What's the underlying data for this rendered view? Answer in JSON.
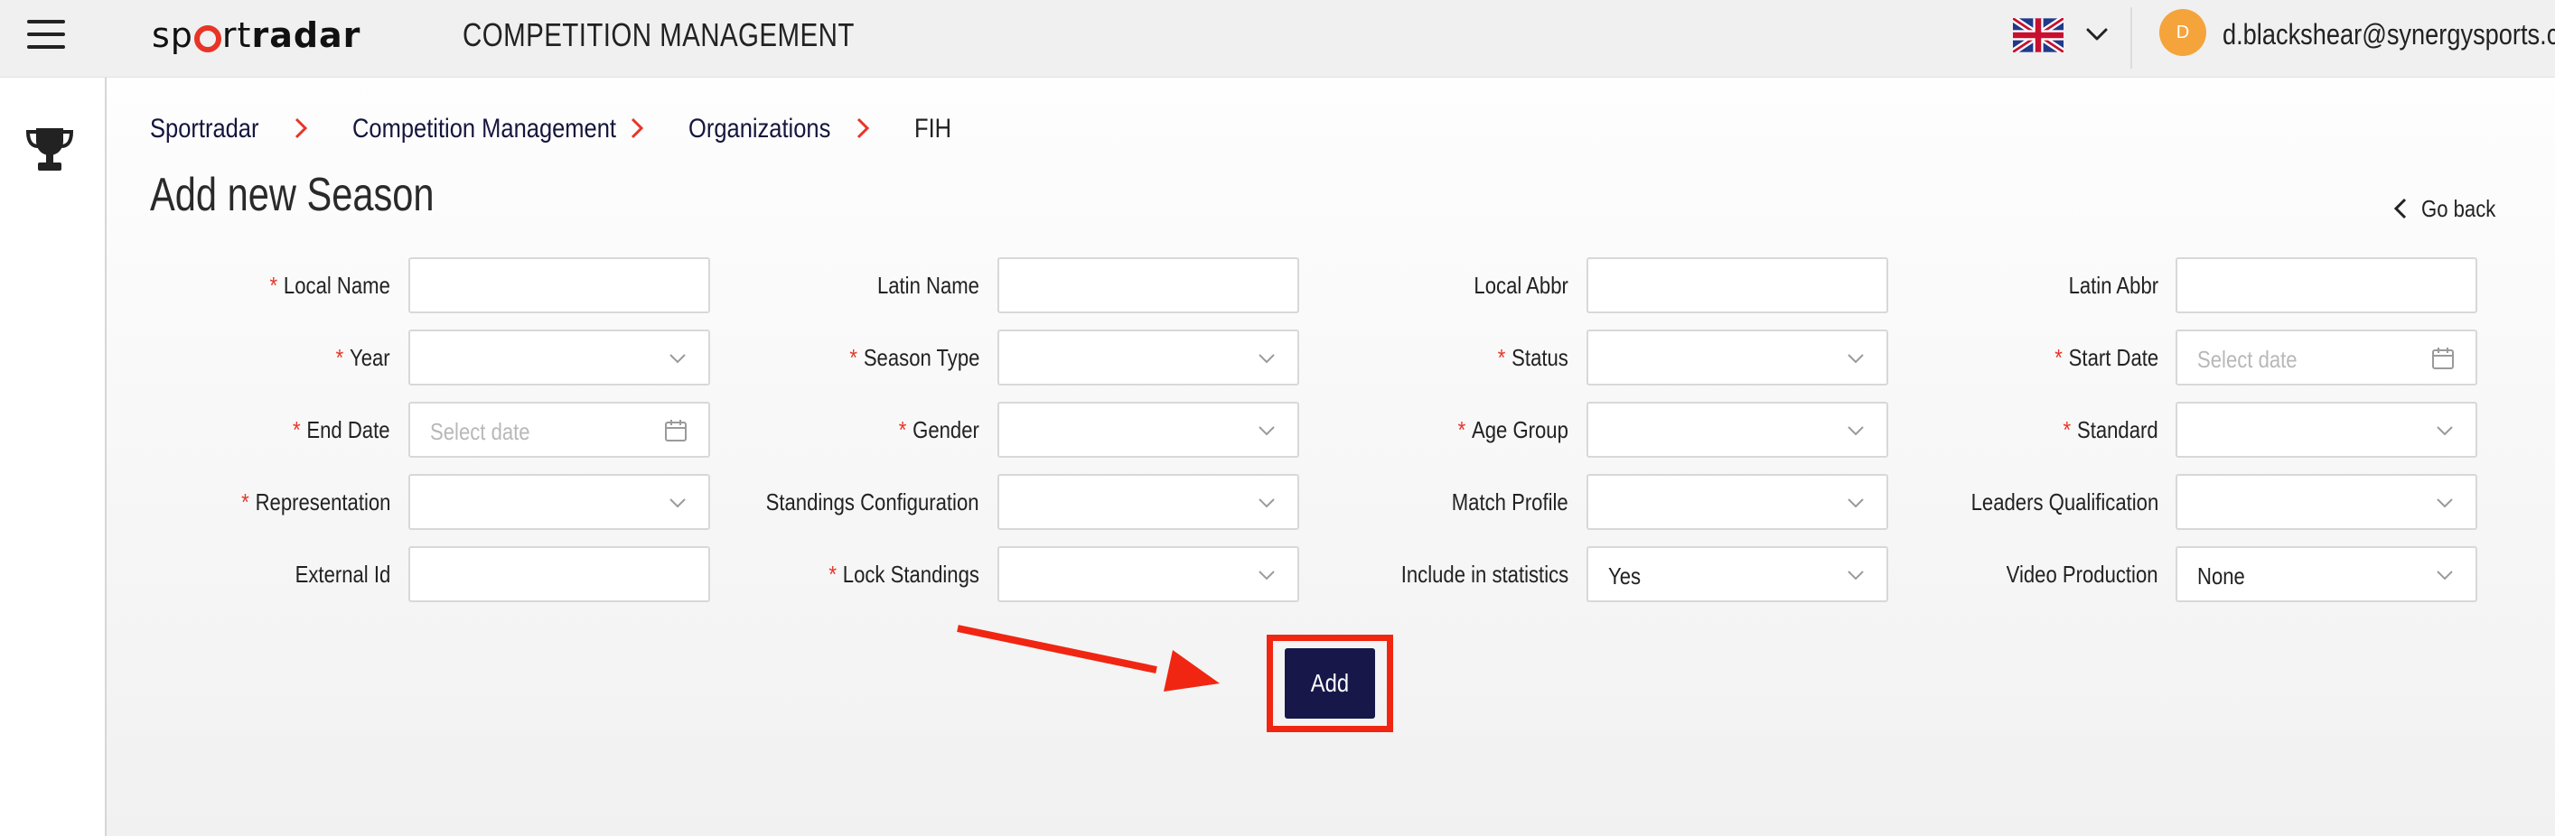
{
  "header": {
    "logo_text": "sportradar",
    "app_title": "COMPETITION MANAGEMENT",
    "language_flag": "uk-flag-icon",
    "user_initial": "D",
    "user_email": "d.blackshear@synergysports.com",
    "avatar_color": "#f4a43b"
  },
  "sidebar": {
    "items": [
      {
        "icon": "trophy-icon"
      }
    ]
  },
  "breadcrumb": {
    "items": [
      {
        "label": "Sportradar"
      },
      {
        "label": "Competition Management"
      },
      {
        "label": "Organizations"
      },
      {
        "label": "FIH"
      }
    ]
  },
  "page": {
    "title": "Add new Season",
    "go_back": "Go back"
  },
  "form": {
    "fields": [
      {
        "label": "Local Name",
        "required": "*",
        "type": "text",
        "value": ""
      },
      {
        "label": "Latin Name",
        "required": "",
        "type": "text",
        "value": ""
      },
      {
        "label": "Local Abbr",
        "required": "",
        "type": "text",
        "value": ""
      },
      {
        "label": "Latin Abbr",
        "required": "",
        "type": "text",
        "value": ""
      },
      {
        "label": "Year",
        "required": "*",
        "type": "select",
        "value": ""
      },
      {
        "label": "Season Type",
        "required": "*",
        "type": "select",
        "value": ""
      },
      {
        "label": "Status",
        "required": "*",
        "type": "select",
        "value": ""
      },
      {
        "label": "Start Date",
        "required": "*",
        "type": "date",
        "placeholder": "Select date"
      },
      {
        "label": "End Date",
        "required": "*",
        "type": "date",
        "placeholder": "Select date"
      },
      {
        "label": "Gender",
        "required": "*",
        "type": "select",
        "value": ""
      },
      {
        "label": "Age Group",
        "required": "*",
        "type": "select",
        "value": ""
      },
      {
        "label": "Standard",
        "required": "*",
        "type": "select",
        "value": ""
      },
      {
        "label": "Representation",
        "required": "*",
        "type": "select",
        "value": ""
      },
      {
        "label": "Standings Configuration",
        "required": "",
        "type": "select",
        "value": ""
      },
      {
        "label": "Match Profile",
        "required": "",
        "type": "select",
        "value": ""
      },
      {
        "label": "Leaders Qualification",
        "required": "",
        "type": "select",
        "value": ""
      },
      {
        "label": "External Id",
        "required": "",
        "type": "text",
        "value": ""
      },
      {
        "label": "Lock Standings",
        "required": "*",
        "type": "select",
        "value": ""
      },
      {
        "label": "Include in statistics",
        "required": "",
        "type": "select",
        "value": "Yes"
      },
      {
        "label": "Video Production",
        "required": "",
        "type": "select",
        "value": "None"
      }
    ],
    "submit_label": "Add"
  },
  "colors": {
    "accent_red": "#e83427",
    "primary_navy": "#17174a",
    "highlight_red": "#f02612"
  }
}
